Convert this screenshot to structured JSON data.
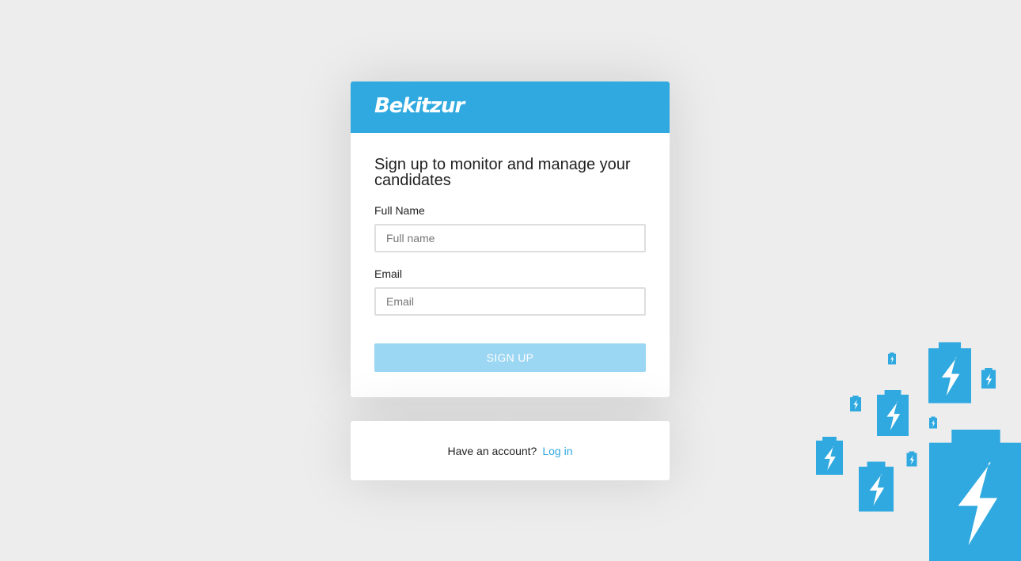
{
  "brand": {
    "logo_text": "Bekitzur",
    "color": "#2fa9e0"
  },
  "signup": {
    "headline": "Sign up to monitor and manage your candidates",
    "full_name_label": "Full Name",
    "full_name_placeholder": "Full name",
    "full_name_value": "",
    "email_label": "Email",
    "email_placeholder": "Email",
    "email_value": "",
    "button_label": "SIGN UP",
    "button_color": "#9bd6f2"
  },
  "login": {
    "prompt": "Have an account?",
    "link_label": "Log in"
  },
  "decoration": {
    "icon": "battery-bolt-icon",
    "color": "#2fa9e0"
  }
}
